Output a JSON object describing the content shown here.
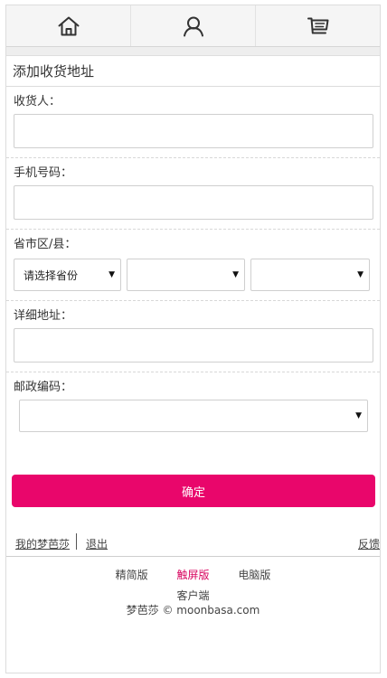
{
  "nav": {
    "items": [
      {
        "icon": "home-icon"
      },
      {
        "icon": "user-icon"
      },
      {
        "icon": "cart-icon"
      }
    ]
  },
  "form": {
    "title": "添加收货地址",
    "recipient_label": "收货人：",
    "phone_label": "手机号码：",
    "region_label": "省市区/县：",
    "province_select": "请选择省份",
    "city_select": "",
    "district_select": "",
    "address_label": "详细地址：",
    "postcode_label": "邮政编码：",
    "postcode_select": "",
    "confirm_label": "确定"
  },
  "links": {
    "my_account": "我的梦芭莎",
    "logout": "退出",
    "feedback": "反馈"
  },
  "footer": {
    "versions": [
      "精简版",
      "触屏版",
      "电脑版"
    ],
    "active_version": "触屏版",
    "client": "客户端",
    "copyright": "梦芭莎 © moonbasa.com"
  },
  "colors": {
    "accent": "#e9066b",
    "active_link": "#d8045f"
  }
}
